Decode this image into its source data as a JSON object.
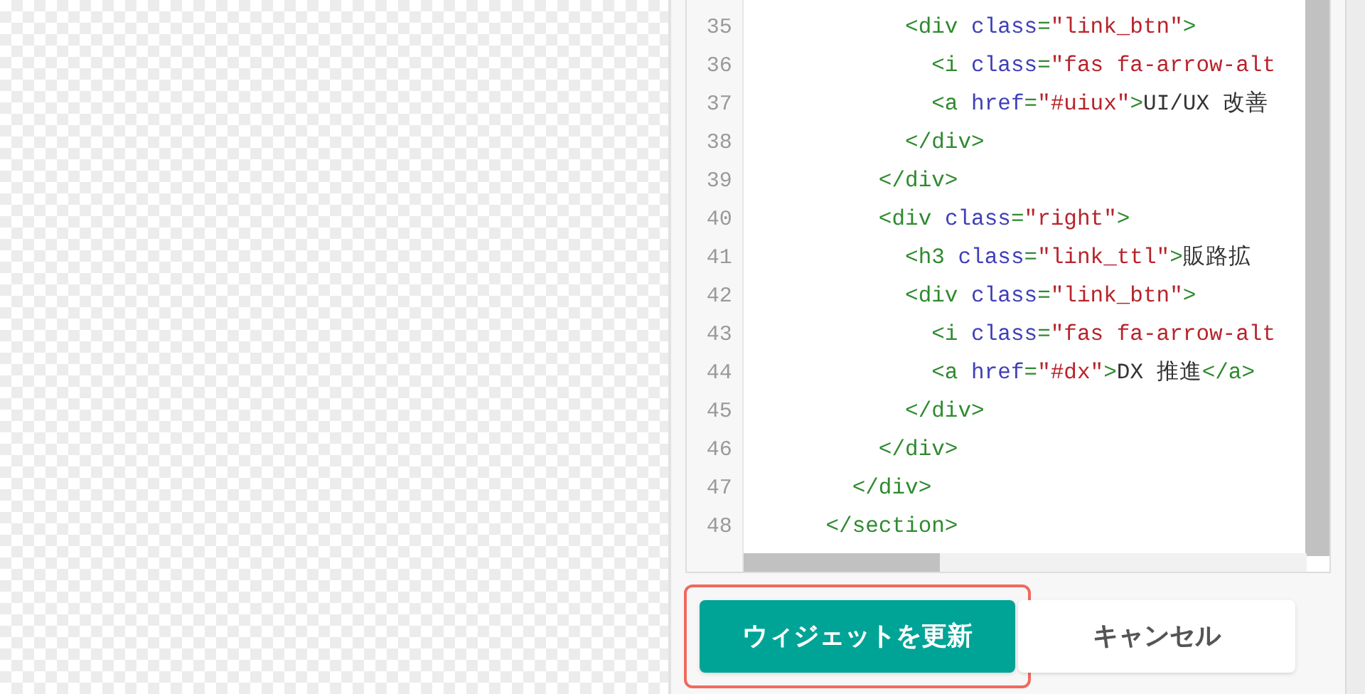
{
  "code_editor": {
    "lines": [
      {
        "number": "35",
        "tokens": [
          {
            "kind": "tag",
            "text": "            <div "
          },
          {
            "kind": "attr",
            "text": "class"
          },
          {
            "kind": "tag",
            "text": "="
          },
          {
            "kind": "string",
            "text": "\"link_btn\""
          },
          {
            "kind": "tag",
            "text": ">"
          }
        ]
      },
      {
        "number": "36",
        "tokens": [
          {
            "kind": "tag",
            "text": "              <i "
          },
          {
            "kind": "attr",
            "text": "class"
          },
          {
            "kind": "tag",
            "text": "="
          },
          {
            "kind": "string",
            "text": "\"fas fa-arrow-alt"
          }
        ]
      },
      {
        "number": "37",
        "tokens": [
          {
            "kind": "tag",
            "text": "              <a "
          },
          {
            "kind": "attr",
            "text": "href"
          },
          {
            "kind": "tag",
            "text": "="
          },
          {
            "kind": "string",
            "text": "\"#uiux\""
          },
          {
            "kind": "tag",
            "text": ">"
          },
          {
            "kind": "text",
            "text": "UI/UX 改善"
          }
        ]
      },
      {
        "number": "38",
        "tokens": [
          {
            "kind": "tag",
            "text": "            </div>"
          }
        ]
      },
      {
        "number": "39",
        "tokens": [
          {
            "kind": "tag",
            "text": "          </div>"
          }
        ]
      },
      {
        "number": "40",
        "tokens": [
          {
            "kind": "tag",
            "text": "          <div "
          },
          {
            "kind": "attr",
            "text": "class"
          },
          {
            "kind": "tag",
            "text": "="
          },
          {
            "kind": "string",
            "text": "\"right\""
          },
          {
            "kind": "tag",
            "text": ">"
          }
        ]
      },
      {
        "number": "41",
        "tokens": [
          {
            "kind": "tag",
            "text": "            <h3 "
          },
          {
            "kind": "attr",
            "text": "class"
          },
          {
            "kind": "tag",
            "text": "="
          },
          {
            "kind": "string",
            "text": "\"link_ttl\""
          },
          {
            "kind": "tag",
            "text": ">"
          },
          {
            "kind": "text",
            "text": "販路拡"
          }
        ]
      },
      {
        "number": "42",
        "tokens": [
          {
            "kind": "tag",
            "text": "            <div "
          },
          {
            "kind": "attr",
            "text": "class"
          },
          {
            "kind": "tag",
            "text": "="
          },
          {
            "kind": "string",
            "text": "\"link_btn\""
          },
          {
            "kind": "tag",
            "text": ">"
          }
        ]
      },
      {
        "number": "43",
        "tokens": [
          {
            "kind": "tag",
            "text": "              <i "
          },
          {
            "kind": "attr",
            "text": "class"
          },
          {
            "kind": "tag",
            "text": "="
          },
          {
            "kind": "string",
            "text": "\"fas fa-arrow-alt"
          }
        ]
      },
      {
        "number": "44",
        "tokens": [
          {
            "kind": "tag",
            "text": "              <a "
          },
          {
            "kind": "attr",
            "text": "href"
          },
          {
            "kind": "tag",
            "text": "="
          },
          {
            "kind": "string",
            "text": "\"#dx\""
          },
          {
            "kind": "tag",
            "text": ">"
          },
          {
            "kind": "text",
            "text": "DX 推進"
          },
          {
            "kind": "tag",
            "text": "</a>"
          }
        ]
      },
      {
        "number": "45",
        "tokens": [
          {
            "kind": "tag",
            "text": "            </div>"
          }
        ]
      },
      {
        "number": "46",
        "tokens": [
          {
            "kind": "tag",
            "text": "          </div>"
          }
        ]
      },
      {
        "number": "47",
        "tokens": [
          {
            "kind": "tag",
            "text": "        </div>"
          }
        ]
      },
      {
        "number": "48",
        "tokens": [
          {
            "kind": "tag",
            "text": "      </section>"
          }
        ]
      }
    ]
  },
  "buttons": [
    {
      "kind": "primary",
      "label": "ウィジェットを更新",
      "focused": true
    },
    {
      "kind": "secondary",
      "label": "キャンセル",
      "focused": false
    }
  ]
}
